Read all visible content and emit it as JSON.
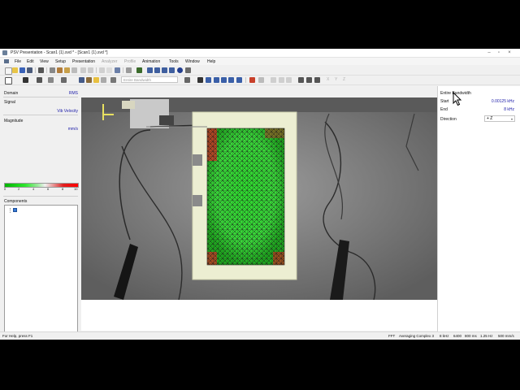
{
  "window": {
    "title": "PSV Presentation - Scan1 (1).svd * - [Scan1 (1).svd *]",
    "controls": [
      "–",
      "▫",
      "×"
    ]
  },
  "menu": {
    "items": [
      {
        "label": "File",
        "enabled": true
      },
      {
        "label": "Edit",
        "enabled": true
      },
      {
        "label": "View",
        "enabled": true
      },
      {
        "label": "Setup",
        "enabled": true
      },
      {
        "label": "Presentation",
        "enabled": true
      },
      {
        "label": "Analyzer",
        "enabled": false
      },
      {
        "label": "Profile",
        "enabled": false
      },
      {
        "label": "Animation",
        "enabled": true
      },
      {
        "label": "Tools",
        "enabled": true
      },
      {
        "label": "Window",
        "enabled": true
      },
      {
        "label": "Help",
        "enabled": true
      }
    ]
  },
  "toolbar": {
    "bandwidth_combo": "Entire Bandwidth",
    "axis_x": "X",
    "axis_y": "Y",
    "axis_z": "Z"
  },
  "left": {
    "domain_label": "Domain",
    "domain_value": "RMS",
    "signal_label": "Signal",
    "signal_value": "Vib Velocity",
    "magnitude_label": "Magnitude",
    "magnitude_unit": "mm/s",
    "ticks": [
      "0",
      "2",
      "4",
      "6",
      "8",
      "10"
    ],
    "components_label": "Components"
  },
  "right": {
    "bandwidth_label": "Entire Bandwidth",
    "start_label": "Start",
    "start_value": "0.00125 kHz",
    "end_label": "End",
    "end_value": "8 kHz",
    "direction_label": "Direction",
    "direction_value": "+ Z"
  },
  "status": {
    "help": "For Help, press F1",
    "mode": "FFT",
    "averaging": "Averaging Complex 3",
    "bandwidth": "8 kHz",
    "lines": "6400",
    "time": "800 ms",
    "resolution": "1.25 Hz",
    "range": "500 mm/s"
  },
  "colors": {
    "accent_value": "#1a1aa8",
    "grid_green": "#33e033",
    "grid_red": "#e00000"
  }
}
